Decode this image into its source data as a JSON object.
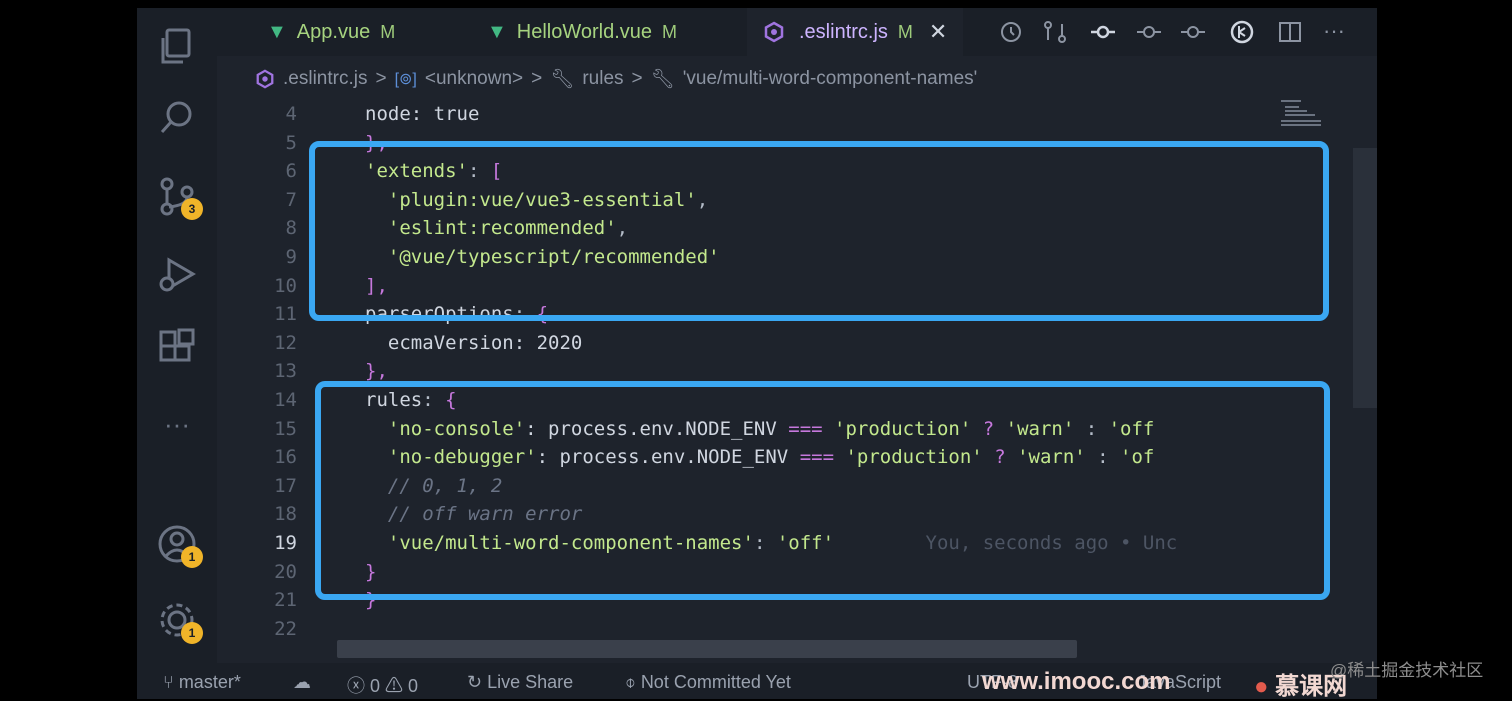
{
  "tabs": [
    {
      "label": "App.vue",
      "badge": "M"
    },
    {
      "label": "HelloWorld.vue",
      "badge": "M"
    },
    {
      "label": ".eslintrc.js",
      "badge": "M",
      "active": true
    }
  ],
  "breadcrumb": {
    "file": ".eslintrc.js",
    "unknown": "<unknown>",
    "rules": "rules",
    "rule": "'vue/multi-word-component-names'",
    "sep": ">"
  },
  "activity_badges": {
    "scm": "3",
    "accounts": "1",
    "settings": "1"
  },
  "activity_more": "···",
  "code_lines": [
    {
      "n": "4",
      "parts": [
        [
          "node: true",
          "k"
        ]
      ]
    },
    {
      "n": "5",
      "parts": [
        [
          "},",
          "br"
        ]
      ]
    },
    {
      "n": "6",
      "parts": [
        [
          "'extends'",
          "s"
        ],
        [
          ": ",
          "p"
        ],
        [
          "[",
          "br"
        ]
      ]
    },
    {
      "n": "7",
      "parts": [
        [
          "  'plugin:vue/vue3-essential'",
          "s"
        ],
        [
          ",",
          "p"
        ]
      ]
    },
    {
      "n": "8",
      "parts": [
        [
          "  'eslint:recommended'",
          "s"
        ],
        [
          ",",
          "p"
        ]
      ]
    },
    {
      "n": "9",
      "parts": [
        [
          "  '@vue/typescript/recommended'",
          "s"
        ]
      ]
    },
    {
      "n": "10",
      "parts": [
        [
          "],",
          "br"
        ]
      ]
    },
    {
      "n": "11",
      "parts": [
        [
          "parserOptions",
          "k"
        ],
        [
          ": ",
          "p"
        ],
        [
          "{",
          "br"
        ]
      ]
    },
    {
      "n": "12",
      "parts": [
        [
          "  ecmaVersion: 2020",
          "k"
        ]
      ]
    },
    {
      "n": "13",
      "parts": [
        [
          "},",
          "br"
        ]
      ]
    },
    {
      "n": "14",
      "parts": [
        [
          "rules",
          "k"
        ],
        [
          ": ",
          "p"
        ],
        [
          "{",
          "br"
        ]
      ]
    },
    {
      "n": "15",
      "parts": [
        [
          "  'no-console'",
          "s"
        ],
        [
          ": process.env.NODE_ENV ",
          "k"
        ],
        [
          "===",
          "op"
        ],
        [
          " 'production'",
          "s"
        ],
        [
          " ? ",
          "q"
        ],
        [
          "'warn'",
          "s"
        ],
        [
          " : ",
          "p"
        ],
        [
          "'off",
          "s"
        ]
      ]
    },
    {
      "n": "16",
      "parts": [
        [
          "  'no-debugger'",
          "s"
        ],
        [
          ": process.env.NODE_ENV ",
          "k"
        ],
        [
          "===",
          "op"
        ],
        [
          " 'production'",
          "s"
        ],
        [
          " ? ",
          "q"
        ],
        [
          "'warn'",
          "s"
        ],
        [
          " : ",
          "p"
        ],
        [
          "'of",
          "s"
        ]
      ]
    },
    {
      "n": "17",
      "parts": [
        [
          "  // 0, 1, 2",
          "c"
        ]
      ]
    },
    {
      "n": "18",
      "parts": [
        [
          "  // off warn error",
          "c"
        ]
      ]
    },
    {
      "n": "19",
      "parts": [
        [
          "  'vue/multi-word-component-names'",
          "s"
        ],
        [
          ": ",
          "p"
        ],
        [
          "'off'",
          "s"
        ],
        [
          "        You, seconds ago • Unc",
          "blame"
        ]
      ],
      "current": true
    },
    {
      "n": "20",
      "parts": [
        [
          "}",
          "br"
        ]
      ]
    },
    {
      "n": "21",
      "parts": [
        [
          "}",
          "br"
        ]
      ]
    },
    {
      "n": "22",
      "parts": []
    }
  ],
  "status": {
    "branch": "master*",
    "errors": "0",
    "warnings": "0",
    "live_share": "Live Share",
    "commit": "Not Committed Yet",
    "encoding": "UTF-8",
    "language": "JavaScript"
  },
  "watermarks": {
    "site": "www.imooc.com",
    "brand": "慕课网",
    "juejin": "@稀土掘金技术社区"
  },
  "colors": {
    "highlight": "#3aa7f2",
    "badge": "#f0b429",
    "string": "#c3e88d",
    "bracket": "#c678dd"
  }
}
